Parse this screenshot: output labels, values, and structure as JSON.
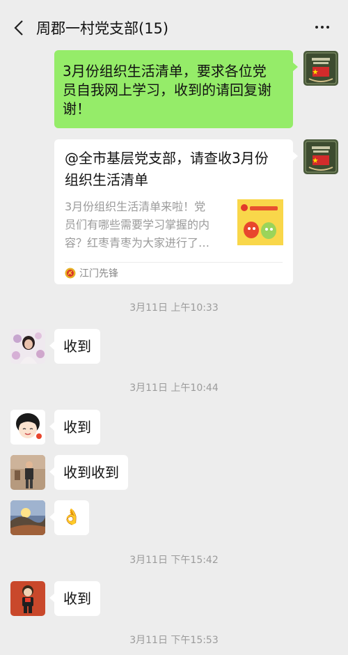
{
  "chat": {
    "title": "周郡一村党支部(15)"
  },
  "messages": {
    "m1": {
      "text_line1": "3月份组织生活清单，要求各位党",
      "text_line2": "员自我网上学习，收到的请回复谢",
      "text_line3": "谢！"
    },
    "m2": {
      "title_line1": "@全市基层党支部，请查收3月份",
      "title_line2": "组织生活清单",
      "desc_line1": "3月份组织生活清单来啦！党",
      "desc_line2": "员们有哪些需要学习掌握的内",
      "desc_line3": "容？红枣青枣为大家进行了…",
      "source": "江门先锋"
    },
    "t1": "3月11日 上午10:33",
    "m3": "收到",
    "t2": "3月11日 上午10:44",
    "m4": "收到",
    "m5": "收到收到",
    "m6_emoji": "👌",
    "t3": "3月11日 下午15:42",
    "m7": "收到",
    "t4": "3月11日 下午15:53"
  },
  "icons": {
    "back": "chevron-left-icon",
    "more": "more-dots-icon",
    "ok_hand": "ok-hand-emoji",
    "source_logo": "party-emblem-icon"
  },
  "colors": {
    "background": "#ededed",
    "outgoing_bubble": "#95ec69",
    "incoming_bubble": "#ffffff",
    "timestamp": "#9b9b9b"
  }
}
